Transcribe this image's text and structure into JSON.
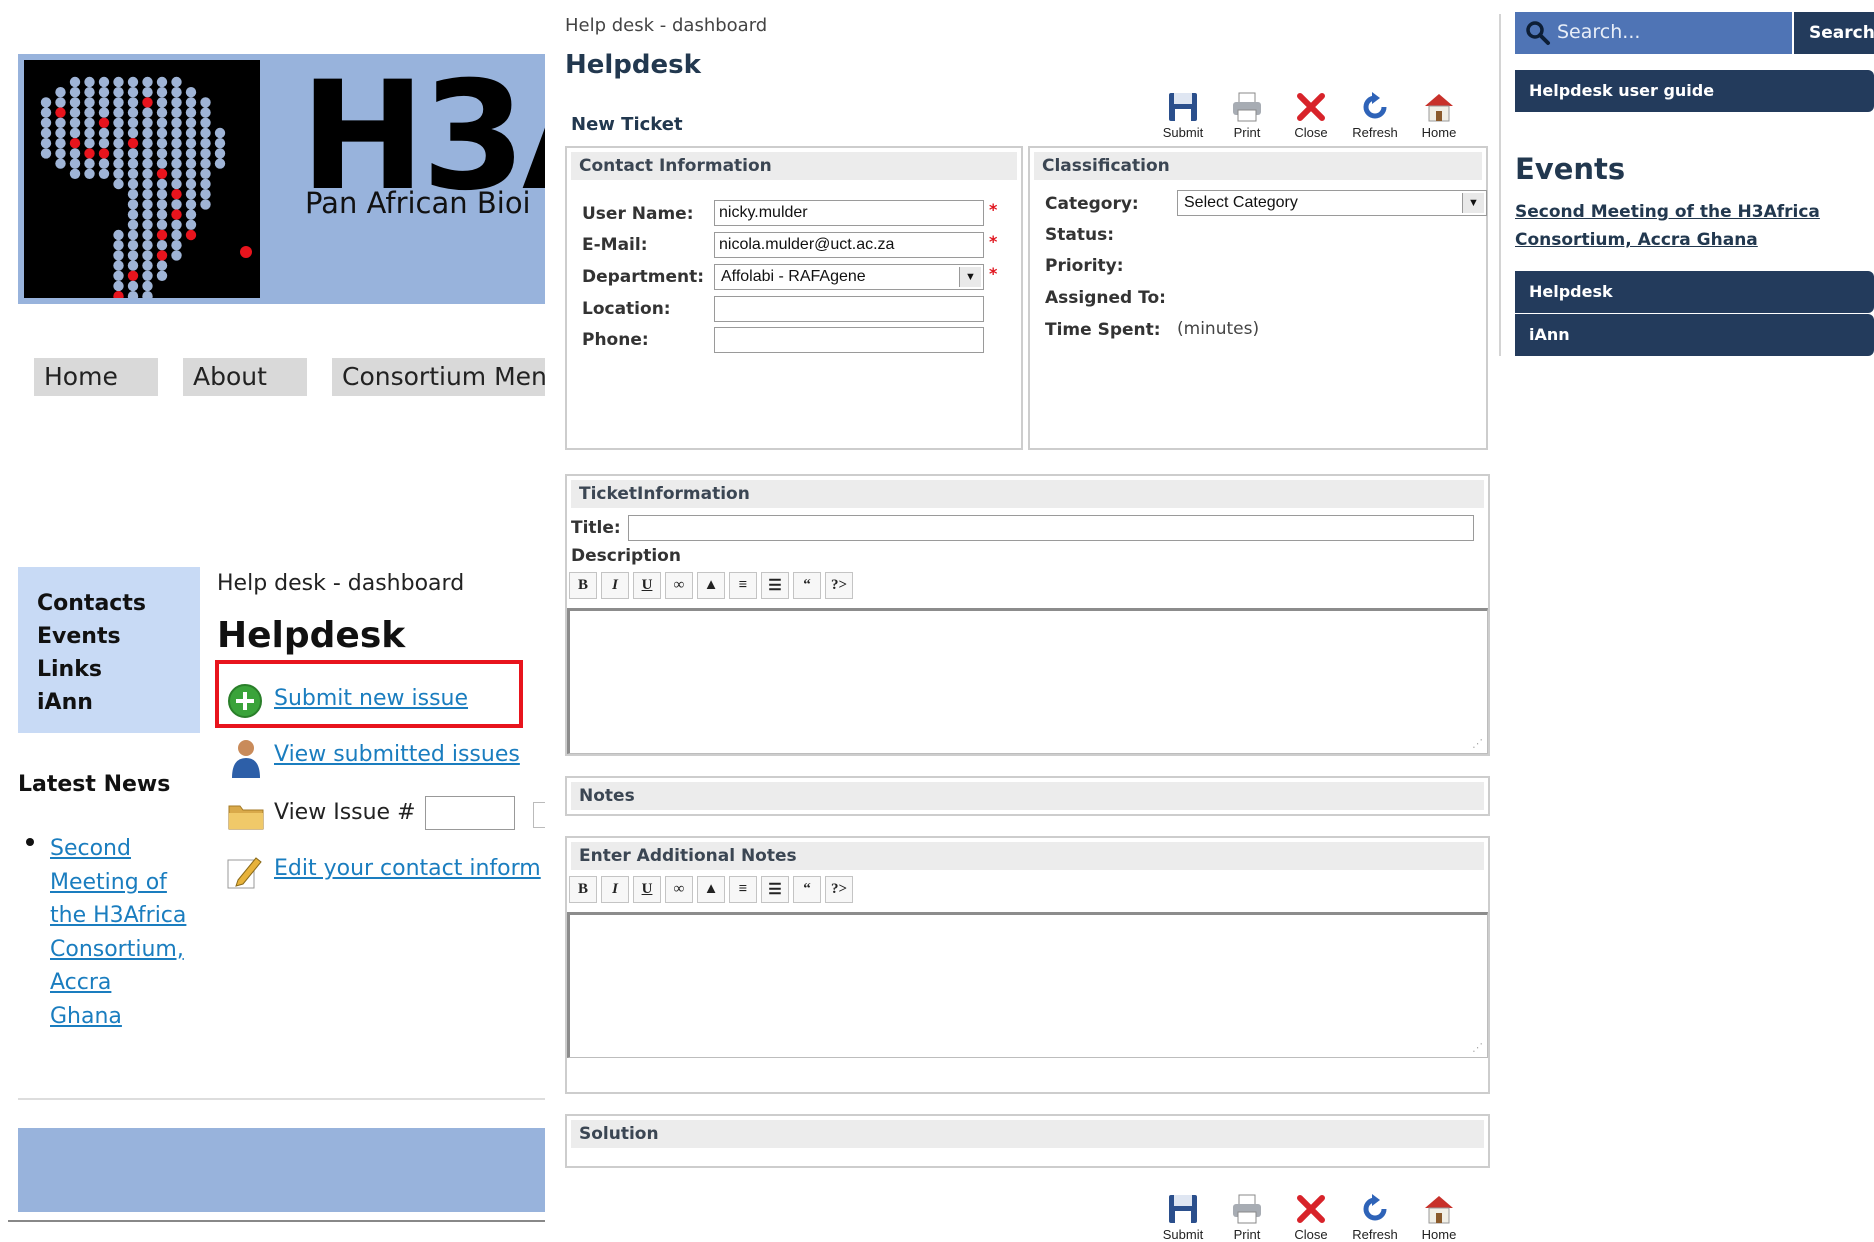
{
  "left": {
    "logo_title": "H3A",
    "logo_subtitle": "Pan African Bioi",
    "nav": [
      "Home",
      "About",
      "Consortium Men"
    ],
    "sidebar": [
      "Contacts",
      "Events",
      "Links",
      "iAnn"
    ],
    "breadcrumb": "Help desk - dashboard",
    "title": "Helpdesk",
    "links": {
      "submit": "Submit new issue",
      "view": "View submitted issues",
      "view_issue": "View Issue #",
      "edit": "Edit your contact inform"
    },
    "latest_news_title": "Latest News",
    "latest_news_item": "Second Meeting of the H3Africa Consortium, Accra Ghana",
    "highlight_color": "#e8141d"
  },
  "center": {
    "breadcrumb": "Help desk - dashboard",
    "title": "Helpdesk",
    "new_ticket": "New Ticket",
    "toolbar": [
      "Submit",
      "Print",
      "Close",
      "Refresh",
      "Home"
    ],
    "contact": {
      "header": "Contact Information",
      "user_name_label": "User Name:",
      "user_name": "nicky.mulder",
      "email_label": "E-Mail:",
      "email": "nicola.mulder@uct.ac.za",
      "department_label": "Department:",
      "department": "Affolabi - RAFAgene",
      "location_label": "Location:",
      "phone_label": "Phone:",
      "required_mark": "*"
    },
    "classification": {
      "header": "Classification",
      "category_label": "Category:",
      "category": "Select Category",
      "status_label": "Status:",
      "priority_label": "Priority:",
      "assigned_label": "Assigned To:",
      "time_label": "Time Spent:",
      "time_unit": "(minutes)"
    },
    "ticket": {
      "header": "TicketInformation",
      "title_label": "Title:",
      "description_label": "Description"
    },
    "editor_buttons": [
      "B",
      "I",
      "U",
      "∞",
      "▲",
      "≡",
      "☰",
      "“",
      "?>"
    ],
    "notes_header": "Notes",
    "additional_notes_header": "Enter Additional Notes",
    "solution_header": "Solution"
  },
  "right": {
    "search_placeholder": "Search...",
    "search_button": "Search",
    "guide": "Helpdesk user guide",
    "events_title": "Events",
    "event_link": "Second Meeting of the H3Africa Consortium, Accra Ghana",
    "menu": [
      "Helpdesk",
      "iAnn"
    ],
    "accent": "#233b5c"
  }
}
